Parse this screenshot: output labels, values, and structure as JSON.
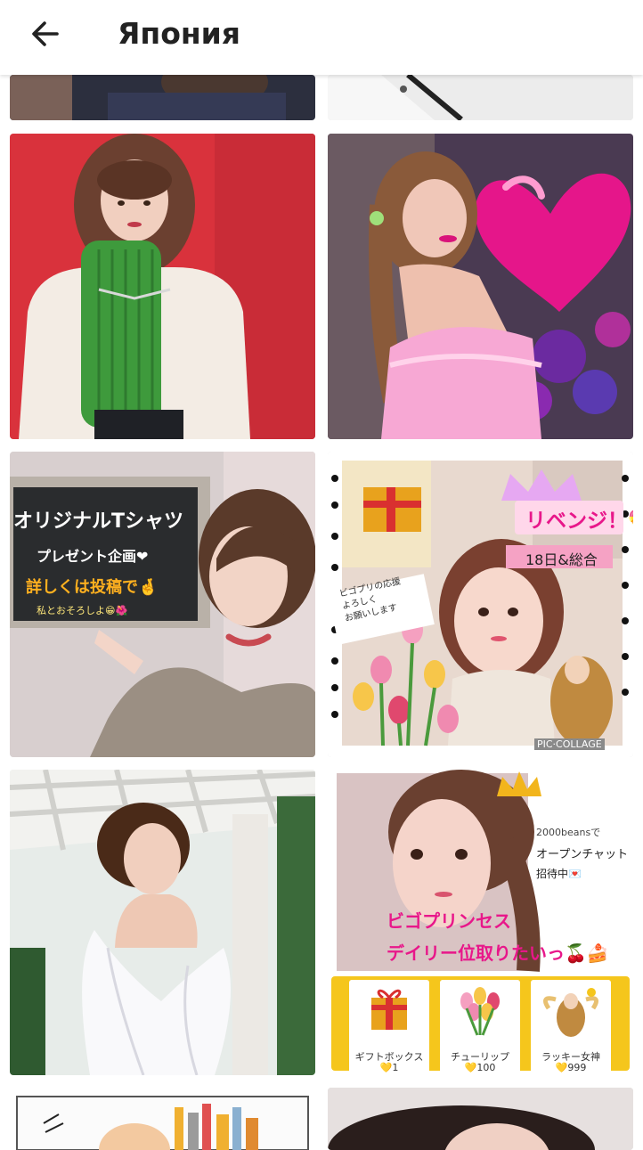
{
  "header": {
    "title": "Япония",
    "back_icon": "arrow-left-icon"
  },
  "cards": [
    {
      "id": "card-1",
      "photo": "woman-green-sweater-red-background"
    },
    {
      "id": "card-2",
      "photo": "woman-pink-heart-balloon"
    },
    {
      "id": "card-3",
      "photo": "woman-pointing-sign",
      "sign_title": "オリジナルTシャツ",
      "sign_line1": "プレゼント企画❤",
      "sign_line2": "詳しくは投稿で🤞",
      "sign_line3": "私とおそろしよ😁🌺"
    },
    {
      "id": "card-4",
      "photo": "collage-girl-crown",
      "banner": "リベンジ！💝",
      "tag": "18日&総合",
      "note": "ビゴプリの応援\nよろしく\nお願いします",
      "watermark": "PIC·COLLAGE"
    },
    {
      "id": "card-5",
      "photo": "short-hair-woman-white-shirt"
    },
    {
      "id": "card-6",
      "photo": "collage-girl-gifts",
      "side_line1": "2000beansで",
      "side_line2": "オープンチャット",
      "side_line3": "招待中💌",
      "pink_line1": "ビゴプリンセス",
      "pink_line2": "デイリー位取りたいっ🍒🍰",
      "gifts": [
        {
          "name": "ギフトボックス",
          "price": "💛1"
        },
        {
          "name": "チューリップ",
          "price": "💛100"
        },
        {
          "name": "ラッキー女神",
          "price": "💛999"
        }
      ]
    }
  ],
  "colors": {
    "header_bg": "#ffffff",
    "title": "#222222",
    "red_bg": "#d9323c",
    "pink": "#e8178a"
  }
}
